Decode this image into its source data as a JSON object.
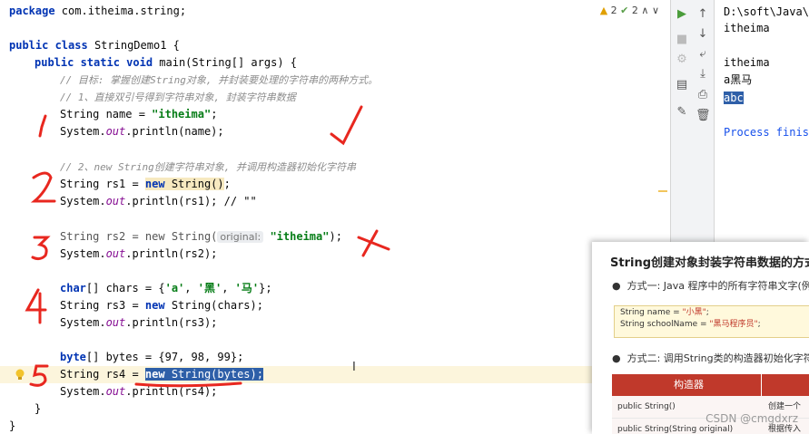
{
  "editor": {
    "inspections": {
      "warnings": "2",
      "ok": "2"
    },
    "lines": {
      "l1_package": "package",
      "l1_name": " com.itheima.string;",
      "l3_public": "public",
      "l3_class": " class",
      "l3_name": " StringDemo1 {",
      "l4_public": "public",
      "l4_static": " static",
      "l4_void": " void",
      "l4_rest": " main(String[] args) {",
      "c1": "// 目标: 掌握创建String对象, 并封装要处理的字符串的两种方式。",
      "c2": "// 1、直接双引号得到字符串对象, 封装字符串数据",
      "l7_pre": "String name = ",
      "l7_str": "\"itheima\"",
      "l7_end": ";",
      "l8_pre": "System.",
      "l8_out": "out",
      "l8_end": ".println(name);",
      "c3": "// 2、new String创建字符串对象, 并调用构造器初始化字符串",
      "l11_pre": "String rs1 = ",
      "l11_new": "new",
      "l11_call": " String()",
      "l11_end": ";",
      "l12_pre": "System.",
      "l12_out": "out",
      "l12_end": ".println(rs1); // \"\"",
      "l14_pre": "String rs2 = new String(",
      "l14_hint": "original:",
      "l14_str": "\"itheima\"",
      "l14_end": ");",
      "l15_pre": "System.",
      "l15_out": "out",
      "l15_end": ".println(rs2);",
      "l17_char": "char",
      "l17_pre": "[] chars = {",
      "l17_a": "'a'",
      "l17_sep1": ", ",
      "l17_b": "'黑'",
      "l17_sep2": ", ",
      "l17_c": "'马'",
      "l17_end": "};",
      "l18_pre": "String rs3 = ",
      "l18_new": "new",
      "l18_end": " String(chars);",
      "l19_pre": "System.",
      "l19_out": "out",
      "l19_end": ".println(rs3);",
      "l21_byte": "byte",
      "l21_end": "[] bytes = {97, 98, 99};",
      "l22_pre": "String rs4 = ",
      "l22_new": "new",
      "l22_sel": " String(bytes);",
      "l23_pre": "System.",
      "l23_out": "out",
      "l23_end": ".println(rs4);",
      "l24": "}",
      "l25": "}"
    }
  },
  "console": {
    "path": "D:\\soft\\Java\\j",
    "out1": "itheima",
    "out2": "itheima",
    "out3": "a黑马",
    "out4": "abc",
    "process": "Process finish"
  },
  "overlay": {
    "title": "String创建对象封装字符串数据的方式",
    "bullet1": "方式一: Java 程序中的所有字符串文字(例",
    "code1_pre": "String name = ",
    "code1_val": "\"小黑\"",
    "code1_end": ";",
    "code2_pre": "String schoolName = ",
    "code2_val": "\"黑马程序员\"",
    "code2_end": ";",
    "bullet2": "方式二: 调用String类的构造器初始化字符",
    "table_header": "构造器",
    "row1": "public String()",
    "row1_desc": "创建一个",
    "row2": "public String(String original)",
    "row2_desc": "根据传入"
  },
  "watermark": "CSDN @cmgdxrz",
  "annotations": {
    "n1": "1",
    "n2": "2",
    "n3": "3",
    "n4": "4",
    "n5": "5"
  },
  "colors": {
    "keyword": "#0033b3",
    "string": "#067d17",
    "comment": "#8c8c8c",
    "annotation_red": "#e8271f",
    "selection": "#2e5fa8"
  }
}
